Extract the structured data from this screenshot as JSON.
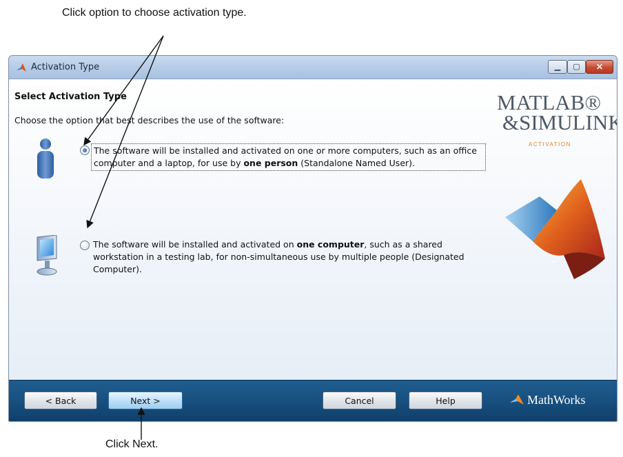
{
  "annotations": {
    "top": "Click option to choose activation type.",
    "bottom": "Click Next."
  },
  "window": {
    "title": "Activation Type",
    "controls": [
      "minimize",
      "maximize",
      "close"
    ]
  },
  "content": {
    "heading": "Select Activation Type",
    "instruction": "Choose the option that best describes the use of the software:",
    "options": [
      {
        "id": "standalone",
        "selected": true,
        "icon": "person-icon",
        "text_before": "The software will be installed and activated on one or more computers, such as an office computer and a laptop, for use by ",
        "bold": "one person",
        "text_after": " (Standalone Named User)."
      },
      {
        "id": "designated",
        "selected": false,
        "icon": "computer-icon",
        "text_before": "The software will be installed and activated on ",
        "bold": "one computer",
        "text_after": ", such as a shared workstation in a testing lab, for non-simultaneous use by multiple people (Designated Computer)."
      }
    ]
  },
  "branding": {
    "line1": "MATLAB®",
    "line2": "&SIMULINK®",
    "line3": "ACTIVATION",
    "footer_logo": "MathWorks"
  },
  "buttons": {
    "back": "< Back",
    "next": "Next >",
    "cancel": "Cancel",
    "help": "Help"
  },
  "colors": {
    "footer": "#17507f",
    "accent_orange": "#e0801f",
    "brand_gray": "#4c5a67"
  }
}
